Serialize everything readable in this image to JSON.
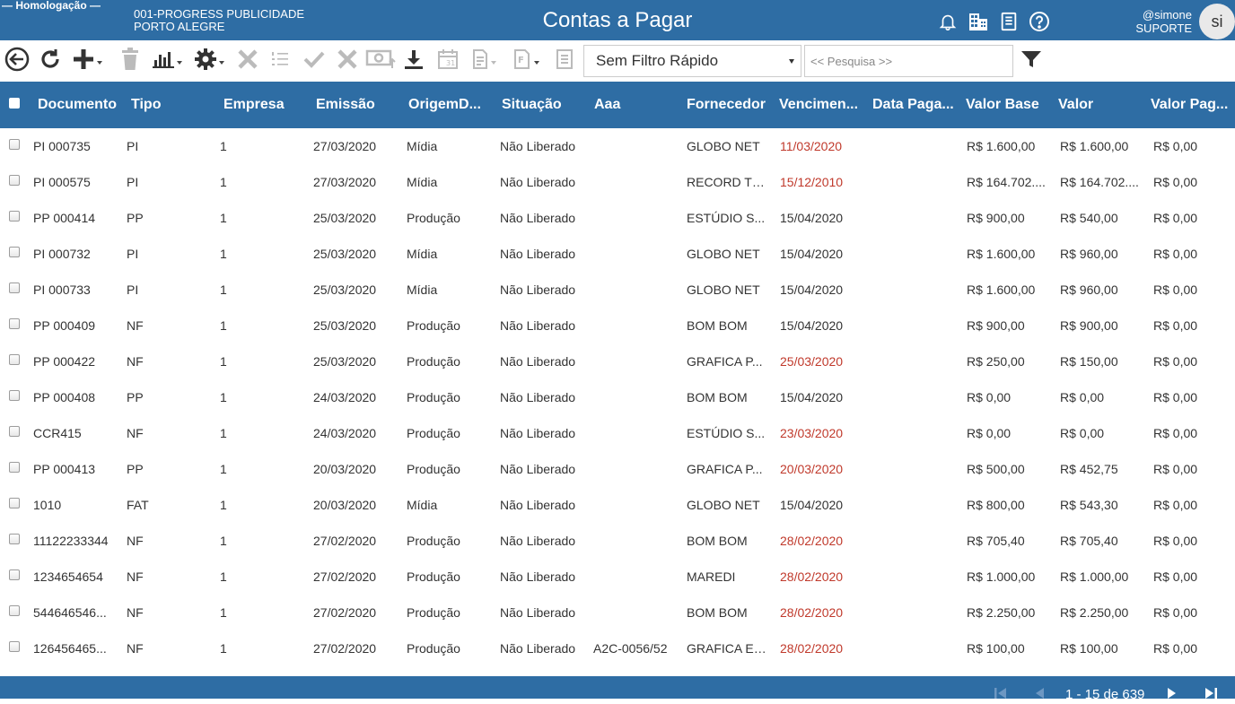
{
  "header": {
    "environment": "Homologação",
    "company_line1": "001-PROGRESS PUBLICIDADE",
    "company_line2": "PORTO ALEGRE",
    "title": "Contas a Pagar",
    "icons": [
      "bell-icon",
      "buildings-icon",
      "document-icon",
      "help-icon"
    ],
    "user_handle": "@simone",
    "user_role": "SUPORTE",
    "avatar_initials": "si",
    "bg_color": "#2e6da4"
  },
  "toolbar": {
    "icons": [
      "back-icon",
      "refresh-icon",
      "add-icon",
      "trash-icon",
      "chart-icon",
      "gear-icon",
      "close-icon",
      "list-numbered-icon",
      "check-icon",
      "cancel-icon",
      "money-upload-icon",
      "download-icon",
      "calendar-icon",
      "report-icon",
      "file-report-icon",
      "notes-icon",
      "filter-icon"
    ],
    "quick_filter_value": "Sem Filtro Rápido",
    "search_placeholder": "<< Pesquisa >>"
  },
  "table": {
    "columns": [
      "Documento",
      "Tipo",
      "Empresa",
      "Emissão",
      "OrigemD...",
      "Situação",
      "Aaa",
      "Fornecedor",
      "Vencimen...",
      "Data Paga...",
      "Valor Base",
      "Valor",
      "Valor Pag..."
    ],
    "rows": [
      {
        "documento": "PI 000735",
        "tipo": "PI",
        "empresa": "1",
        "emissao": "27/03/2020",
        "origem": "Mídia",
        "situacao": "Não Liberado",
        "aaa": "",
        "fornecedor": "GLOBO NET",
        "vencimento": "11/03/2020",
        "vencido": true,
        "data_pagamento": "",
        "valor_base": "R$ 1.600,00",
        "valor": "R$ 1.600,00",
        "valor_pago": "R$ 0,00"
      },
      {
        "documento": "PI 000575",
        "tipo": "PI",
        "empresa": "1",
        "emissao": "27/03/2020",
        "origem": "Mídia",
        "situacao": "Não Liberado",
        "aaa": "",
        "fornecedor": "RECORD TV...",
        "vencimento": "15/12/2010",
        "vencido": true,
        "data_pagamento": "",
        "valor_base": "R$ 164.702....",
        "valor": "R$ 164.702....",
        "valor_pago": "R$ 0,00"
      },
      {
        "documento": "PP 000414",
        "tipo": "PP",
        "empresa": "1",
        "emissao": "25/03/2020",
        "origem": "Produção",
        "situacao": "Não Liberado",
        "aaa": "",
        "fornecedor": "ESTÚDIO S...",
        "vencimento": "15/04/2020",
        "vencido": false,
        "data_pagamento": "",
        "valor_base": "R$ 900,00",
        "valor": "R$ 540,00",
        "valor_pago": "R$ 0,00"
      },
      {
        "documento": "PI 000732",
        "tipo": "PI",
        "empresa": "1",
        "emissao": "25/03/2020",
        "origem": "Mídia",
        "situacao": "Não Liberado",
        "aaa": "",
        "fornecedor": "GLOBO NET",
        "vencimento": "15/04/2020",
        "vencido": false,
        "data_pagamento": "",
        "valor_base": "R$ 1.600,00",
        "valor": "R$ 960,00",
        "valor_pago": "R$ 0,00"
      },
      {
        "documento": "PI 000733",
        "tipo": "PI",
        "empresa": "1",
        "emissao": "25/03/2020",
        "origem": "Mídia",
        "situacao": "Não Liberado",
        "aaa": "",
        "fornecedor": "GLOBO NET",
        "vencimento": "15/04/2020",
        "vencido": false,
        "data_pagamento": "",
        "valor_base": "R$ 1.600,00",
        "valor": "R$ 960,00",
        "valor_pago": "R$ 0,00"
      },
      {
        "documento": "PP 000409",
        "tipo": "NF",
        "empresa": "1",
        "emissao": "25/03/2020",
        "origem": "Produção",
        "situacao": "Não Liberado",
        "aaa": "",
        "fornecedor": "BOM BOM",
        "vencimento": "15/04/2020",
        "vencido": false,
        "data_pagamento": "",
        "valor_base": "R$ 900,00",
        "valor": "R$ 900,00",
        "valor_pago": "R$ 0,00"
      },
      {
        "documento": "PP 000422",
        "tipo": "NF",
        "empresa": "1",
        "emissao": "25/03/2020",
        "origem": "Produção",
        "situacao": "Não Liberado",
        "aaa": "",
        "fornecedor": "GRAFICA P...",
        "vencimento": "25/03/2020",
        "vencido": true,
        "data_pagamento": "",
        "valor_base": "R$ 250,00",
        "valor": "R$ 150,00",
        "valor_pago": "R$ 0,00"
      },
      {
        "documento": "PP 000408",
        "tipo": "PP",
        "empresa": "1",
        "emissao": "24/03/2020",
        "origem": "Produção",
        "situacao": "Não Liberado",
        "aaa": "",
        "fornecedor": "BOM BOM",
        "vencimento": "15/04/2020",
        "vencido": false,
        "data_pagamento": "",
        "valor_base": "R$ 0,00",
        "valor": "R$ 0,00",
        "valor_pago": "R$ 0,00"
      },
      {
        "documento": "CCR415",
        "tipo": "NF",
        "empresa": "1",
        "emissao": "24/03/2020",
        "origem": "Produção",
        "situacao": "Não Liberado",
        "aaa": "",
        "fornecedor": "ESTÚDIO S...",
        "vencimento": "23/03/2020",
        "vencido": true,
        "data_pagamento": "",
        "valor_base": "R$ 0,00",
        "valor": "R$ 0,00",
        "valor_pago": "R$ 0,00"
      },
      {
        "documento": "PP 000413",
        "tipo": "PP",
        "empresa": "1",
        "emissao": "20/03/2020",
        "origem": "Produção",
        "situacao": "Não Liberado",
        "aaa": "",
        "fornecedor": "GRAFICA P...",
        "vencimento": "20/03/2020",
        "vencido": true,
        "data_pagamento": "",
        "valor_base": "R$ 500,00",
        "valor": "R$ 452,75",
        "valor_pago": "R$ 0,00"
      },
      {
        "documento": "1010",
        "tipo": "FAT",
        "empresa": "1",
        "emissao": "20/03/2020",
        "origem": "Mídia",
        "situacao": "Não Liberado",
        "aaa": "",
        "fornecedor": "GLOBO NET",
        "vencimento": "15/04/2020",
        "vencido": false,
        "data_pagamento": "",
        "valor_base": "R$ 800,00",
        "valor": "R$ 543,30",
        "valor_pago": "R$ 0,00"
      },
      {
        "documento": "11122233344",
        "tipo": "NF",
        "empresa": "1",
        "emissao": "27/02/2020",
        "origem": "Produção",
        "situacao": "Não Liberado",
        "aaa": "",
        "fornecedor": "BOM BOM",
        "vencimento": "28/02/2020",
        "vencido": true,
        "data_pagamento": "",
        "valor_base": "R$ 705,40",
        "valor": "R$ 705,40",
        "valor_pago": "R$ 0,00"
      },
      {
        "documento": "1234654654",
        "tipo": "NF",
        "empresa": "1",
        "emissao": "27/02/2020",
        "origem": "Produção",
        "situacao": "Não Liberado",
        "aaa": "",
        "fornecedor": "MAREDI",
        "vencimento": "28/02/2020",
        "vencido": true,
        "data_pagamento": "",
        "valor_base": "R$ 1.000,00",
        "valor": "R$ 1.000,00",
        "valor_pago": "R$ 0,00"
      },
      {
        "documento": "544646546...",
        "tipo": "NF",
        "empresa": "1",
        "emissao": "27/02/2020",
        "origem": "Produção",
        "situacao": "Não Liberado",
        "aaa": "",
        "fornecedor": "BOM BOM",
        "vencimento": "28/02/2020",
        "vencido": true,
        "data_pagamento": "",
        "valor_base": "R$ 2.250,00",
        "valor": "R$ 2.250,00",
        "valor_pago": "R$ 0,00"
      },
      {
        "documento": "126456465...",
        "tipo": "NF",
        "empresa": "1",
        "emissao": "27/02/2020",
        "origem": "Produção",
        "situacao": "Não Liberado",
        "aaa": "A2C-0056/52",
        "fornecedor": "GRAFICA E ...",
        "vencimento": "28/02/2020",
        "vencido": true,
        "data_pagamento": "",
        "valor_base": "R$ 100,00",
        "valor": "R$ 100,00",
        "valor_pago": "R$ 0,00"
      }
    ],
    "overdue_color": "#c0392b"
  },
  "footer": {
    "pager_text": "1 - 15 de 639",
    "icons": [
      "first-page-icon",
      "prev-page-icon",
      "next-page-icon",
      "last-page-icon"
    ]
  }
}
